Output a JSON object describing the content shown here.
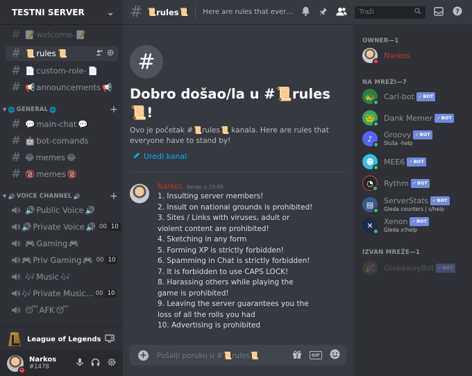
{
  "server": {
    "name": "TESTNI SERVER"
  },
  "channels": {
    "top": [
      {
        "name": "welcome-",
        "emoji_before": "📝",
        "emoji_after": "📝"
      },
      {
        "name": "rules",
        "emoji_before": "📜",
        "emoji_after": "📜"
      },
      {
        "name": "custom-role-",
        "emoji_before": "📄",
        "emoji_after": "📄"
      },
      {
        "name": "announcements",
        "emoji_before": "📢",
        "emoji_after": "📢"
      }
    ],
    "general_label": "GENERAL",
    "general": [
      {
        "name": "main-chat",
        "emoji_before": "💬",
        "emoji_after": "💬"
      },
      {
        "name": "bot-comands",
        "emoji_before": "🤖",
        "emoji_after": ""
      },
      {
        "name": "memes",
        "emoji_before": "😂",
        "emoji_after": "😂"
      },
      {
        "name": "memes",
        "emoji_before": "🔞",
        "emoji_after": "🔞"
      }
    ],
    "voice_label": "VOICE CHANNEL",
    "voice": [
      {
        "name": "Public Voice",
        "emoji_before": "🔊",
        "emoji_after": "🔊",
        "count_a": "",
        "count_b": ""
      },
      {
        "name": "Private Voice",
        "emoji_before": "🔊",
        "emoji_after": "🔊",
        "count_a": "00",
        "count_b": "10"
      },
      {
        "name": "Gaming",
        "emoji_before": "🎮",
        "emoji_after": "🎮",
        "count_a": "",
        "count_b": ""
      },
      {
        "name": "Priv Gaming",
        "emoji_before": "🎮",
        "emoji_after": "🎮",
        "count_a": "00",
        "count_b": "10"
      },
      {
        "name": "Music",
        "emoji_before": "🎶",
        "emoji_after": "🎶",
        "count_a": "",
        "count_b": ""
      },
      {
        "name": "Private Music...",
        "emoji_before": "🎶",
        "emoji_after": "",
        "count_a": "00",
        "count_b": "10"
      },
      {
        "name": "AFK",
        "emoji_before": "😴",
        "emoji_after": "😴",
        "count_a": "",
        "count_b": ""
      }
    ]
  },
  "game_activity": {
    "name": "League of Legends"
  },
  "user": {
    "name": "Narkos",
    "tag": "#1478"
  },
  "topbar": {
    "channel": "rules",
    "channel_emoji": "📜",
    "topic": "Here are rules that everyone have to stand by!",
    "search_placeholder": "Traži"
  },
  "welcome": {
    "title_prefix": "Dobro došao/la u #",
    "emoji": "📜",
    "title_channel": "rules",
    "title_suffix": "!",
    "subtitle_prefix": "Ovo je početak #",
    "subtitle_channel": "rules",
    "subtitle_suffix": " kanala. Here are rules that everyone have to stand by!",
    "edit_label": "Uredi kanal"
  },
  "message": {
    "author": "Narkos",
    "timestamp": "danas u 19:40",
    "lines": [
      "1. Insulting server members!",
      "2. Insult on national grounds is prohibited!",
      "3. Sites / Links with viruses, adult or violent content are prohibited!",
      "4. Sketching in any form",
      "5. Forming XP is strictly forbidden!",
      "6. Spamming in Chat is strictly forbidden!",
      "7. It is forbidden to use CAPS LOCK!",
      "8. Harassing others while playing the game is prohibited!",
      "9. Leaving the server guarantees you the loss of all the rolls you had",
      "10. Advertising is prohibited"
    ]
  },
  "composer": {
    "placeholder_prefix": "Pošalji poruku u #",
    "placeholder_channel": "rules"
  },
  "members": {
    "owner_label": "OWNER—1",
    "online_label": "NA MREŽI—7",
    "offline_label": "IZVAN MREŽE—1",
    "bot_label": "BOT",
    "owner": {
      "name": "Narkos",
      "color": "#c0392b"
    },
    "online": [
      {
        "name": "Carl-bot",
        "status": "",
        "avatar_color": "#2d7d46",
        "avatar_glyph": "🐢"
      },
      {
        "name": "Dank Memer",
        "status": "",
        "avatar_color": "#3ba55c",
        "avatar_glyph": "🐸"
      },
      {
        "name": "Groovy",
        "status": "Sluša -help",
        "avatar_color": "#5865f2",
        "avatar_glyph": "♪"
      },
      {
        "name": "MEE6",
        "status": "",
        "avatar_color": "#3bbcd9",
        "avatar_glyph": "☻"
      },
      {
        "name": "Rythm",
        "status": "",
        "avatar_color": "#23272a",
        "avatar_glyph": "◔"
      },
      {
        "name": "ServerStats",
        "status": "Gleda counters | s/help",
        "avatar_color": "#3b5a8a",
        "avatar_glyph": "▤"
      },
      {
        "name": "Xenon",
        "status": "Gleda x!help",
        "avatar_color": "#1e2a4a",
        "avatar_glyph": "✕"
      }
    ],
    "offline": [
      {
        "name": "GiveawayBot",
        "avatar_color": "#4f545c",
        "avatar_glyph": "🎉"
      }
    ]
  },
  "colors": {
    "accent": "#7289da",
    "link": "#00b0f4",
    "dnd": "#f04747",
    "online": "#43b581"
  }
}
